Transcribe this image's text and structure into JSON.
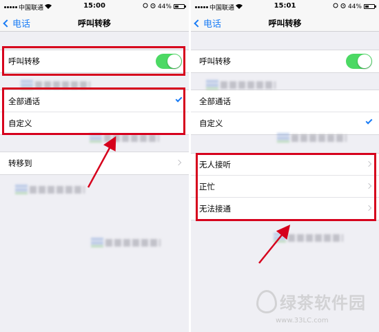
{
  "status_bar": {
    "carrier": "中国联通",
    "left_time": "15:00",
    "right_time": "15:01",
    "battery": "44%",
    "battery_level": 0.44
  },
  "nav": {
    "back_label": "电话",
    "title": "呼叫转移"
  },
  "left_screen": {
    "call_forwarding_label": "呼叫转移",
    "call_forwarding_enabled": true,
    "mode_options": [
      {
        "label": "全部通话",
        "selected": true
      },
      {
        "label": "自定义",
        "selected": false
      }
    ],
    "forward_to_label": "转移到"
  },
  "right_screen": {
    "call_forwarding_label": "呼叫转移",
    "call_forwarding_enabled": true,
    "mode_options": [
      {
        "label": "全部通话",
        "selected": false
      },
      {
        "label": "自定义",
        "selected": true
      }
    ],
    "conditions": [
      {
        "label": "无人接听"
      },
      {
        "label": "正忙"
      },
      {
        "label": "无法接通"
      }
    ]
  },
  "watermark": {
    "site_name": "绿茶软件园",
    "site_url": "www.33LC.com"
  },
  "colors": {
    "accent": "#1a7cf5",
    "toggle_on": "#4cd964",
    "highlight": "#d6001c",
    "background": "#efeff4"
  },
  "icons": [
    "wifi-icon",
    "alarm-icon",
    "lock-rotation-icon",
    "battery-icon",
    "chevron-left-icon",
    "checkmark-icon",
    "chevron-right-icon"
  ]
}
